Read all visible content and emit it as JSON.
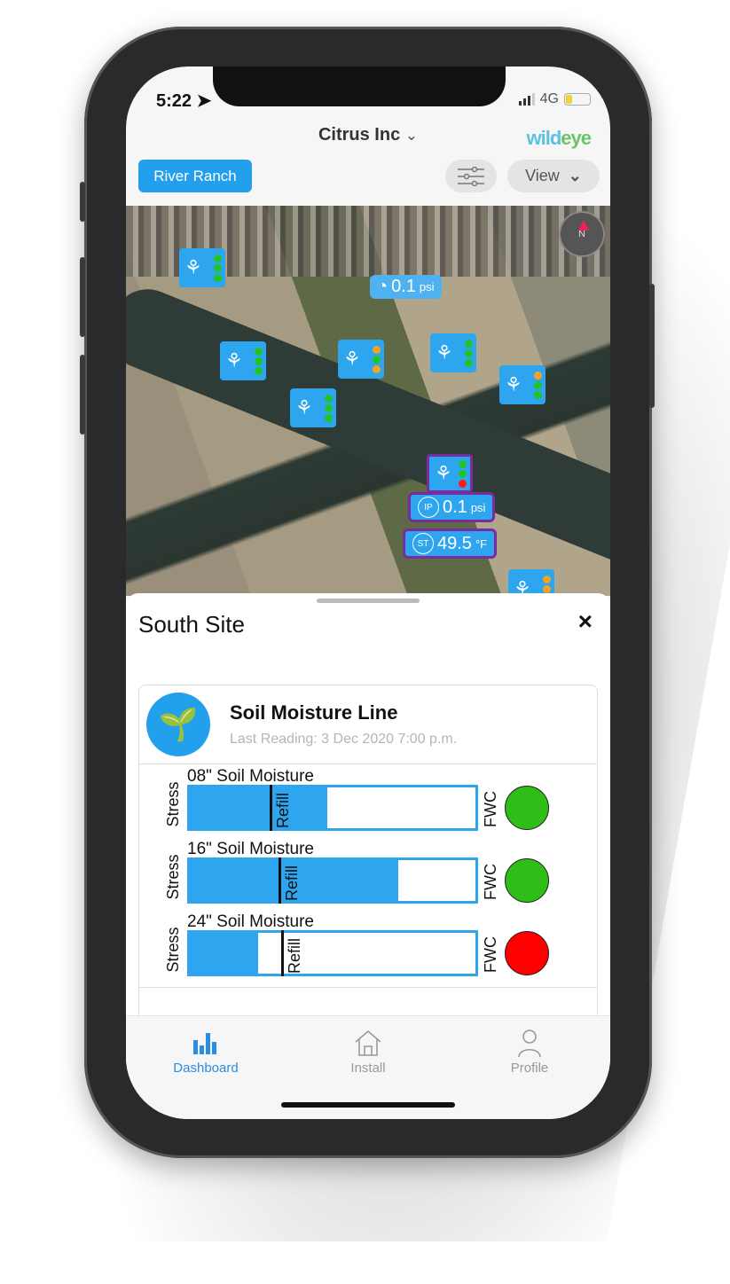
{
  "status_bar": {
    "time": "5:22",
    "network": "4G"
  },
  "header": {
    "title": "Citrus Inc",
    "logo": "wildeye",
    "ranch_button": "River Ranch",
    "view_button": "View",
    "filter_icon": "sliders-icon"
  },
  "map": {
    "compass_label": "N",
    "markers": [
      {
        "dots": [
          "#22c32a",
          "#22c32a",
          "#22c32a"
        ]
      },
      {
        "dots": [
          "#22c32a",
          "#22c32a",
          "#22c32a"
        ]
      },
      {
        "dots": [
          "#f4a31f",
          "#22c32a",
          "#f4a31f"
        ]
      },
      {
        "dots": [
          "#22c32a",
          "#22c32a",
          "#22c32a"
        ]
      },
      {
        "dots": [
          "#f4a31f",
          "#22c32a",
          "#22c32a"
        ]
      },
      {
        "dots": [
          "#22c32a",
          "#22c32a",
          "#22c32a"
        ]
      },
      {
        "dots": [
          "#22c32a",
          "#22c32a",
          "#ff1a1a"
        ],
        "selected": true
      },
      {
        "dots": [
          "#f4a31f",
          "#f4a31f",
          "#f4a31f"
        ]
      }
    ],
    "pressure_readout": {
      "value": "0.1",
      "unit": "psi"
    },
    "selected_readouts": [
      {
        "badge": "IP",
        "value": "0.1",
        "unit": "psi"
      },
      {
        "badge": "ST",
        "value": "49.5",
        "unit": "°F"
      }
    ]
  },
  "sheet": {
    "title": "South Site",
    "close": "×",
    "card": {
      "title": "Soil Moisture Line",
      "subtitle": "Last Reading: 3 Dec 2020 7:00 p.m.",
      "sensors": [
        {
          "label": "08\" Soil Moisture",
          "stress": "Stress",
          "refill": "Refill",
          "fwc": "FWC",
          "fill": 0.48,
          "refill_point": 0.28,
          "status_color": "#2fbe17"
        },
        {
          "label": "16\" Soil Moisture",
          "stress": "Stress",
          "refill": "Refill",
          "fwc": "FWC",
          "fill": 0.73,
          "refill_point": 0.31,
          "status_color": "#2fbe17"
        },
        {
          "label": "24\" Soil Moisture",
          "stress": "Stress",
          "refill": "Refill",
          "fwc": "FWC",
          "fill": 0.24,
          "refill_point": 0.32,
          "status_color": "#ff0000"
        }
      ]
    }
  },
  "tabbar": {
    "items": [
      {
        "label": "Dashboard",
        "active": true
      },
      {
        "label": "Install"
      },
      {
        "label": "Profile"
      }
    ]
  },
  "colors": {
    "accent": "#23a0ec",
    "selected_border": "#7a2b9e"
  }
}
